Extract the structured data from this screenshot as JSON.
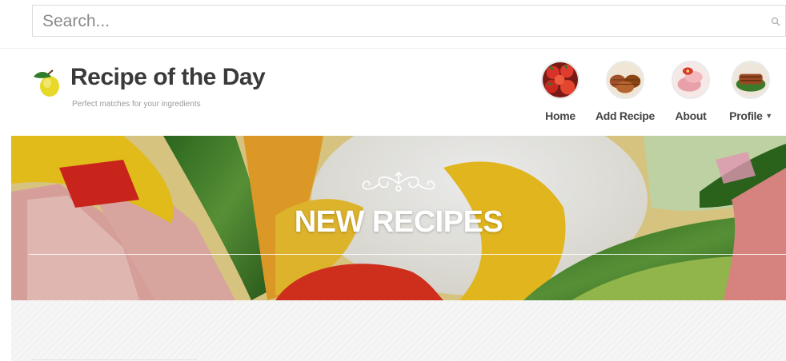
{
  "search": {
    "placeholder": "Search..."
  },
  "header": {
    "title": "Recipe of the Day",
    "tagline": "Perfect matches for your ingredients"
  },
  "nav": {
    "items": [
      {
        "label": "Home",
        "icon": "tomatoes-thumbnail"
      },
      {
        "label": "Add Recipe",
        "icon": "pastries-thumbnail"
      },
      {
        "label": "About",
        "icon": "ham-thumbnail"
      },
      {
        "label": "Profile",
        "icon": "grilled-meat-thumbnail",
        "has_dropdown": true
      }
    ]
  },
  "hero": {
    "title": "NEW RECIPES",
    "colors": {
      "text": "#ffffff",
      "pepper": "#f2c21b",
      "cucumber": "#3f7a2b",
      "ham": "#e8a49a"
    }
  }
}
